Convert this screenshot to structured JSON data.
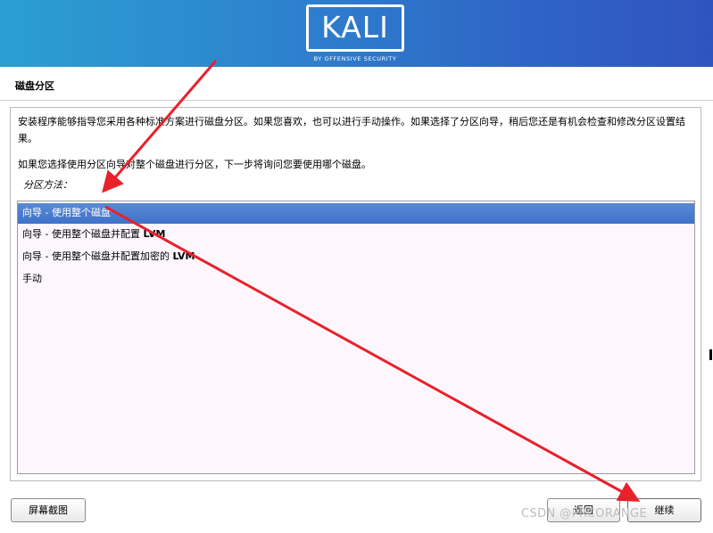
{
  "brand": {
    "logo": "KALI",
    "tagline": "BY OFFENSIVE SECURITY"
  },
  "page": {
    "title": "磁盘分区"
  },
  "content": {
    "paragraph1": "安装程序能够指导您采用各种标准方案进行磁盘分区。如果您喜欢，也可以进行手动操作。如果选择了分区向导，稍后您还是有机会检查和修改分区设置结果。",
    "paragraph2": "如果您选择使用分区向导对整个磁盘进行分区，下一步将询问您要使用哪个磁盘。",
    "method_label": "分区方法："
  },
  "options": [
    {
      "prefix": "向导 - 使用整个磁盘",
      "suffix": "",
      "selected": true
    },
    {
      "prefix": "向导 - 使用整个磁盘并配置 ",
      "suffix": "LVM",
      "selected": false
    },
    {
      "prefix": "向导 - 使用整个磁盘并配置加密的 ",
      "suffix": "LVM",
      "selected": false
    },
    {
      "prefix": "手动",
      "suffix": "",
      "selected": false
    }
  ],
  "buttons": {
    "screenshot": "屏幕截图",
    "back": "返回",
    "continue": "继续"
  },
  "watermark": "CSDN @PRCORANGE",
  "colors": {
    "selection": "#3e72c9",
    "arrow": "#e8212b",
    "banner": "#2d86cf"
  }
}
